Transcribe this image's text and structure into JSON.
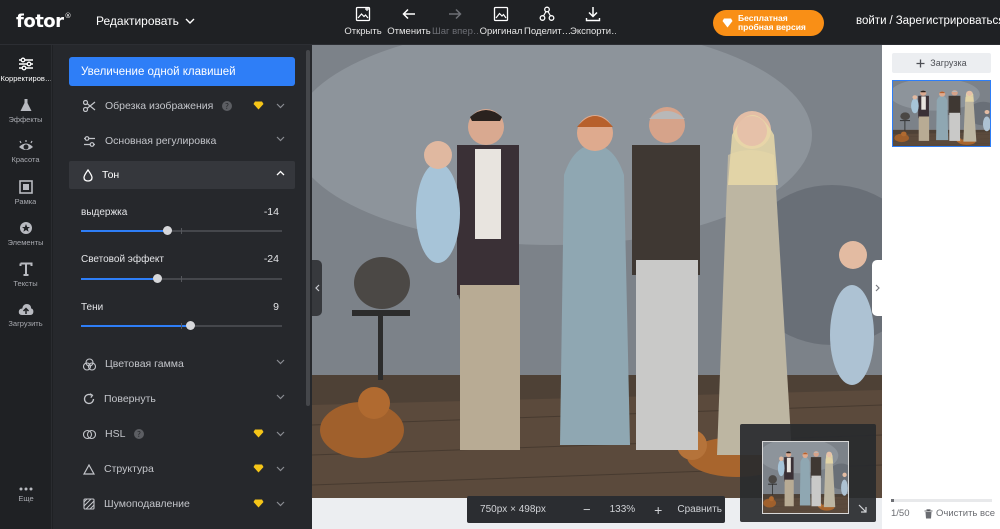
{
  "app": {
    "brand": "fotor",
    "edit_menu": "Редактировать"
  },
  "toolbar": [
    {
      "label": "Открыть",
      "icon": "open-image-icon",
      "enabled": true
    },
    {
      "label": "Отменить",
      "icon": "undo-icon",
      "enabled": true
    },
    {
      "label": "Шаг впер…",
      "icon": "redo-icon",
      "enabled": false
    },
    {
      "label": "Оригинал",
      "icon": "original-icon",
      "enabled": true
    },
    {
      "label": "Поделит…",
      "icon": "share-icon",
      "enabled": true
    },
    {
      "label": "Экспорти…",
      "icon": "export-icon",
      "enabled": true
    }
  ],
  "trial": {
    "line1": "Бесплатная",
    "line2": "пробная версия",
    "color": "#f98f16"
  },
  "auth": {
    "login": "войти",
    "sep": "/",
    "register": "Зарегистрироваться"
  },
  "leftnav": [
    {
      "label": "Корректиров…",
      "icon": "sliders-icon",
      "active": true
    },
    {
      "label": "Эффекты",
      "icon": "flask-icon",
      "active": false
    },
    {
      "label": "Красота",
      "icon": "eye-icon",
      "active": false
    },
    {
      "label": "Рамка",
      "icon": "frame-icon",
      "active": false
    },
    {
      "label": "Элементы",
      "icon": "elements-icon",
      "active": false
    },
    {
      "label": "Тексты",
      "icon": "text-icon",
      "active": false
    },
    {
      "label": "Загрузить",
      "icon": "upload-cloud-icon",
      "active": false
    }
  ],
  "leftnav_more": "Еще",
  "panel": {
    "magic": "Увеличение одной клавишей",
    "crop": "Обрезка изображения",
    "basic": "Основная регулировка",
    "tone": "Тон",
    "sliders": [
      {
        "label": "выдержка",
        "value": "-14",
        "level": -14
      },
      {
        "label": "Световой эффект",
        "value": "-24",
        "level": -24
      },
      {
        "label": "Тени",
        "value": "9",
        "level": 9
      }
    ],
    "color": "Цветовая гамма",
    "rotate": "Повернуть",
    "hsl": "HSL",
    "structure": "Структура",
    "noise": "Шумоподавление"
  },
  "canvas": {
    "dims": "750px × 498px",
    "zoom_out": "−",
    "zoom": "133%",
    "zoom_in": "+",
    "compare": "Сравнить"
  },
  "right": {
    "upload": "Загрузка",
    "count": "1/50",
    "clear": "Очистить все"
  },
  "colors": {
    "accent": "#2e7ef7",
    "premium": "#f5c518"
  }
}
